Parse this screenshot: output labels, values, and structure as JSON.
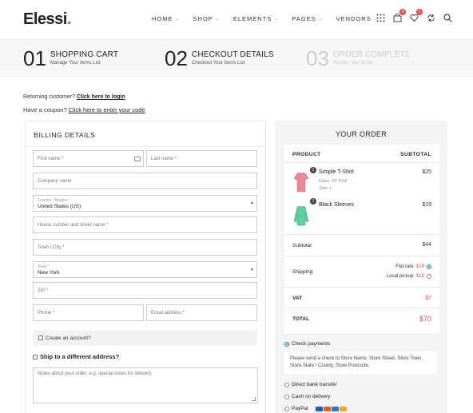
{
  "header": {
    "logo": "Elessi",
    "logo_dot": ".",
    "nav": [
      "HOME",
      "SHOP",
      "ELEMENTS",
      "PAGES",
      "VENDORS"
    ],
    "cart_count": "0",
    "wishlist_count": "1"
  },
  "steps": [
    {
      "num": "01",
      "title": "SHOPPING CART",
      "sub": "Manage Your Items List"
    },
    {
      "num": "02",
      "title": "CHECKOUT DETAILS",
      "sub": "Checkout Your Items List"
    },
    {
      "num": "03",
      "title": "ORDER COMPLETE",
      "sub": "Review Your Order"
    }
  ],
  "notices": {
    "returning": "Returning customer?",
    "login_link": "Click here to login",
    "coupon": "Have a coupon?",
    "coupon_link": "Click here to enter your code"
  },
  "billing": {
    "title": "BILLING DETAILS",
    "first_name": "First name *",
    "last_name": "Last name *",
    "company": "Company name",
    "country_label": "Country / Region *",
    "country_value": "United States (US)",
    "street": "House number and street name *",
    "town": "Town / City *",
    "state_label": "State *",
    "state_value": "New York",
    "zip": "ZIP *",
    "phone": "Phone *",
    "email": "Email address *",
    "create_account": "Create an account?",
    "ship_different": "Ship to a different address?",
    "notes_placeholder": "Notes about your order, e.g. special notes for delivery."
  },
  "order": {
    "title": "YOUR ORDER",
    "col_product": "PRODUCT",
    "col_subtotal": "SUBTOTAL",
    "items": [
      {
        "qty": "1",
        "name": "Simple T-Shirt",
        "color": "Color: ST Pink",
        "size": "Size: L",
        "price": "$25"
      },
      {
        "qty": "1",
        "name": "Black Sleeves",
        "price": "$19"
      }
    ],
    "subtotal_label": "Subtotal",
    "subtotal_value": "$44",
    "shipping_label": "Shipping",
    "flat_rate_label": "Flat rate:",
    "flat_rate_value": "$19",
    "local_pickup_label": "Local pickup:",
    "local_pickup_value": "$15",
    "vat_label": "VAT",
    "vat_value": "$7",
    "total_label": "TOTAL",
    "total_value": "$70"
  },
  "payment": {
    "check": "Check payments",
    "check_desc": "Please send a check to Store Name, Store Street, Store Town, Store State / County, Store Postcode.",
    "bank": "Direct bank transfer",
    "cod": "Cash on delivery",
    "paypal": "PayPal"
  },
  "colors": {
    "accent": "#e44d4d",
    "radio": "#1e73be",
    "pink_shirt": "#e88a93",
    "green_sleeves": "#5fcf9f"
  }
}
